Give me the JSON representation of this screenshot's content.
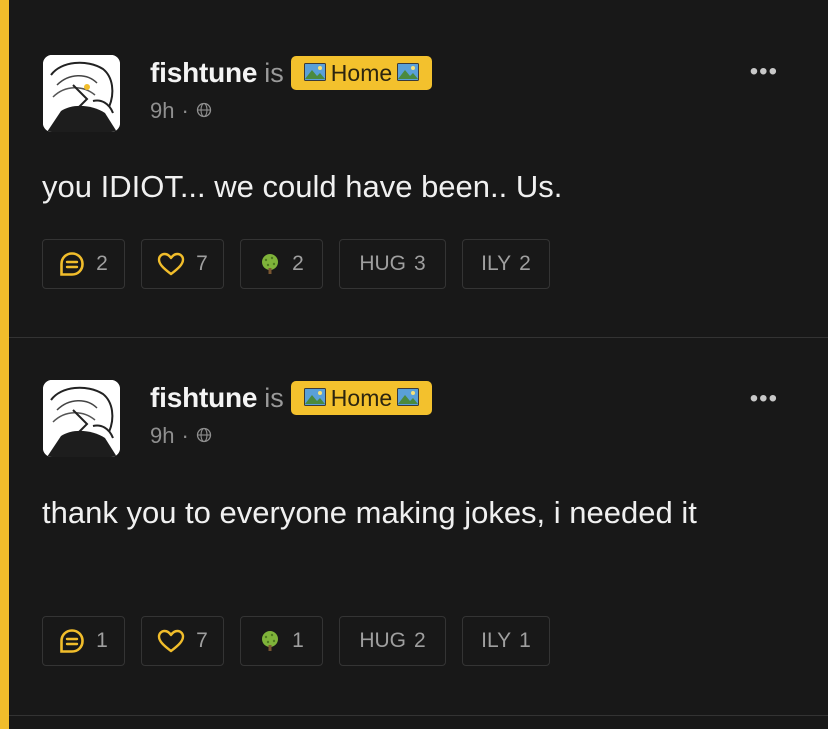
{
  "accent_color": "#f1bd2b",
  "posts": [
    {
      "author": "fishtune",
      "is_word": "is",
      "status_label": "Home",
      "status_icon": "landscape-picture-emoji",
      "time": "9h",
      "separator": "·",
      "visibility_icon": "globe-icon",
      "more_icon": "•••",
      "text": "you IDIOT... we could have been.. Us.",
      "actions": {
        "replies": "2",
        "likes": "7",
        "trees": "2",
        "hug_label": "HUG",
        "hugs": "3",
        "ily_label": "ILY",
        "ily": "2"
      }
    },
    {
      "author": "fishtune",
      "is_word": "is",
      "status_label": "Home",
      "status_icon": "landscape-picture-emoji",
      "time": "9h",
      "separator": "·",
      "visibility_icon": "globe-icon",
      "more_icon": "•••",
      "text": "thank you to everyone making jokes, i needed it",
      "actions": {
        "replies": "1",
        "likes": "7",
        "trees": "1",
        "hug_label": "HUG",
        "hugs": "2",
        "ily_label": "ILY",
        "ily": "1"
      }
    }
  ]
}
